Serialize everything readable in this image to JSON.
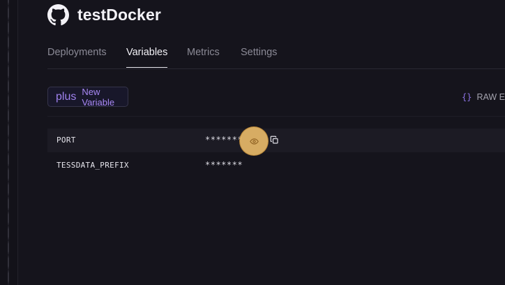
{
  "project": {
    "title": "testDocker",
    "icon": "github-icon"
  },
  "tabs": [
    {
      "label": "Deployments",
      "active": false
    },
    {
      "label": "Variables",
      "active": true
    },
    {
      "label": "Metrics",
      "active": false
    },
    {
      "label": "Settings",
      "active": false
    }
  ],
  "toolbar": {
    "new_variable_label": "New Variable",
    "new_variable_icon": "plus",
    "raw_editor_icon": "{}",
    "raw_editor_label": "RAW Ed"
  },
  "variables": [
    {
      "name": "PORT",
      "value": "*******"
    },
    {
      "name": "TESSDATA_PREFIX",
      "value": "*******"
    }
  ],
  "colors": {
    "background": "#15141c",
    "accent": "#a888f4",
    "highlight": "#e7b969"
  }
}
